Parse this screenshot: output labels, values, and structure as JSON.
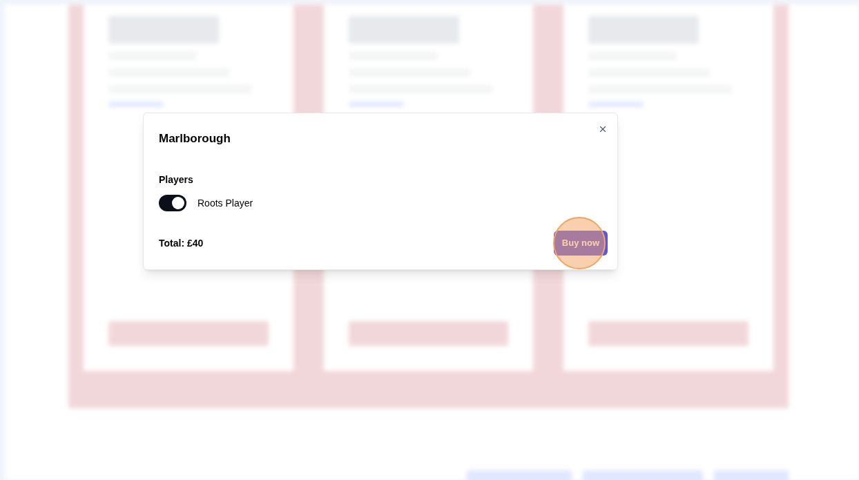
{
  "modal": {
    "title": "Marlborough",
    "section_label": "Players",
    "players": [
      {
        "label": "Roots Player",
        "on": true
      }
    ],
    "total": "Total: £40",
    "buy_button": "Buy now",
    "click_highlight": true
  }
}
